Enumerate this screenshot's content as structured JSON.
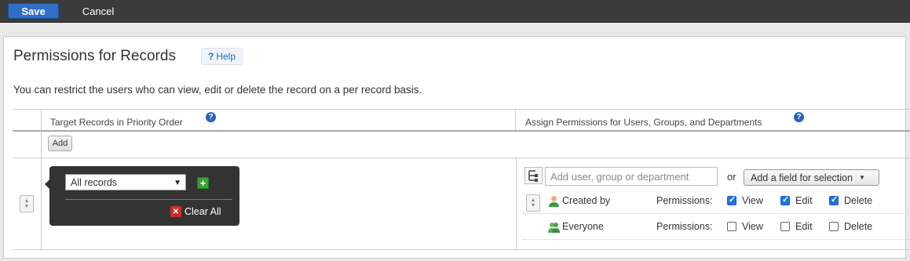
{
  "toolbar": {
    "save_label": "Save",
    "cancel_label": "Cancel"
  },
  "page": {
    "title": "Permissions for Records",
    "help_label": "Help",
    "description": "You can restrict the users who can view, edit or delete the record on a per record basis."
  },
  "table": {
    "col1_header": "Target Records in Priority Order",
    "col2_header": "Assign Permissions for Users, Groups, and Departments",
    "add_label": "Add"
  },
  "record": {
    "condition_value": "All records",
    "clear_all_label": "Clear All",
    "user_placeholder": "Add user, group or department",
    "or_label": "or",
    "field_select_label": "Add a field for selection",
    "permissions_label": "Permissions:",
    "entities": [
      {
        "name": "Created by",
        "icon": "user-icon",
        "view": true,
        "edit": true,
        "delete": true
      },
      {
        "name": "Everyone",
        "icon": "group-icon",
        "view": false,
        "edit": false,
        "delete": false
      }
    ],
    "perm_names": {
      "view": "View",
      "edit": "Edit",
      "delete": "Delete"
    }
  }
}
